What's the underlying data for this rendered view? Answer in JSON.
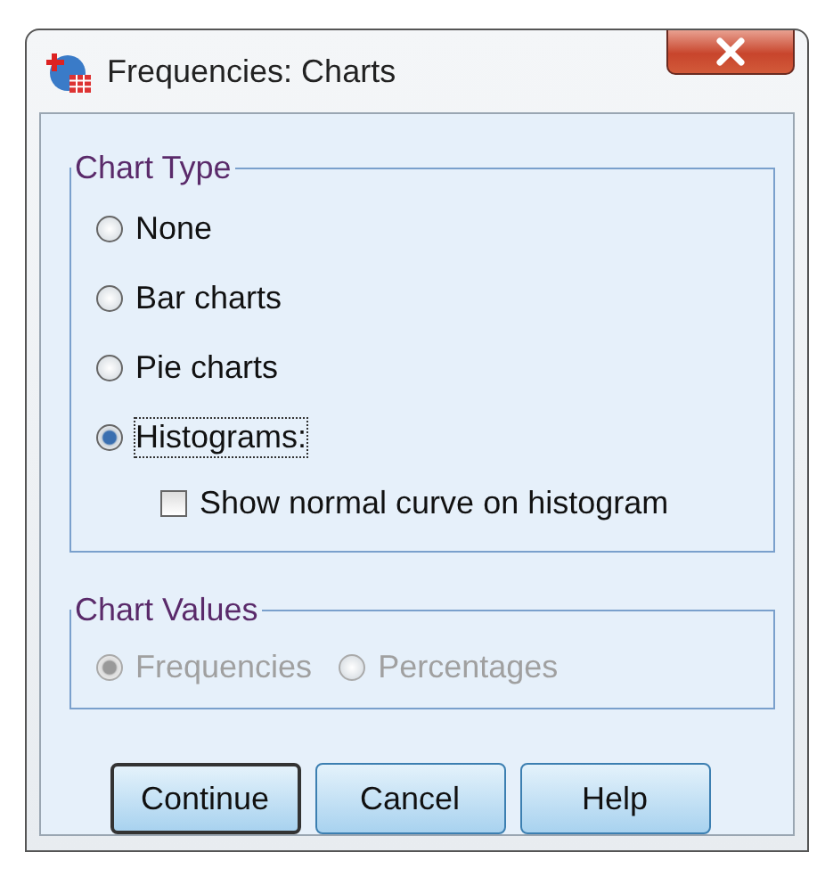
{
  "window": {
    "title": "Frequencies: Charts"
  },
  "chart_type": {
    "legend": "Chart Type",
    "options": [
      {
        "label": "None",
        "selected": false,
        "focused": false
      },
      {
        "label": "Bar charts",
        "selected": false,
        "focused": false
      },
      {
        "label": "Pie charts",
        "selected": false,
        "focused": false
      },
      {
        "label": "Histograms:",
        "selected": true,
        "focused": true
      }
    ],
    "normal_curve": {
      "label": "Show normal curve on histogram",
      "checked": false
    }
  },
  "chart_values": {
    "legend": "Chart Values",
    "disabled": true,
    "options": [
      {
        "label": "Frequencies",
        "selected": true
      },
      {
        "label": "Percentages",
        "selected": false
      }
    ]
  },
  "buttons": [
    {
      "label": "Continue",
      "default": true
    },
    {
      "label": "Cancel",
      "default": false
    },
    {
      "label": "Help",
      "default": false
    }
  ]
}
